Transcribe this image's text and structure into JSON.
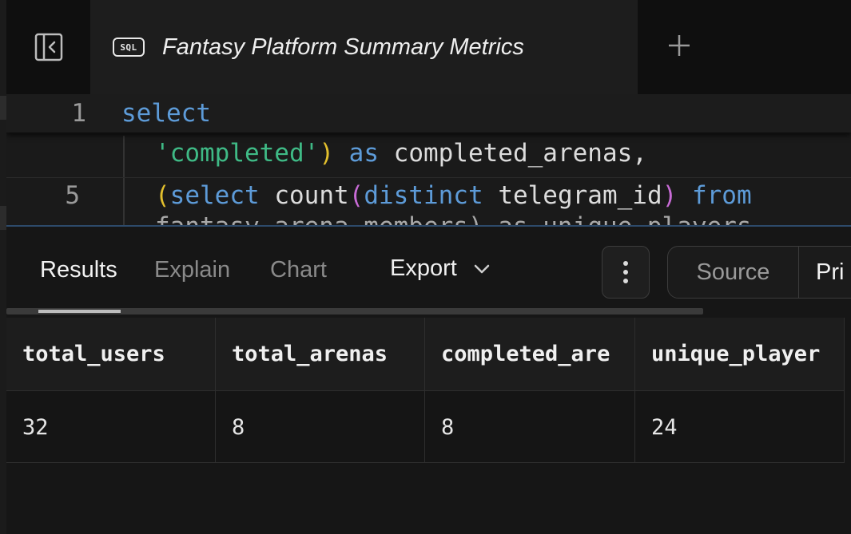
{
  "tab": {
    "icon_label": "SQL",
    "title": "Fantasy Platform Summary Metrics"
  },
  "editor": {
    "line_1_number": "1",
    "line_1_code": "select",
    "wrap_line": {
      "string": "'completed'",
      "paren_close": ")",
      "keyword": "as",
      "rest": "completed_arenas,"
    },
    "line_5_number": "5",
    "line_5": {
      "paren_open": "(",
      "select_kw": "select",
      "count_fn": "count",
      "inner_paren_open": "(",
      "distinct_kw": "distinct",
      "column": "telegram_id",
      "inner_paren_close": ")",
      "from_kw": "from"
    },
    "partial_line": "fantasy_arena_members) as unique_players"
  },
  "results_toolbar": {
    "tabs": [
      "Results",
      "Explain",
      "Chart"
    ],
    "active_tab": "Results",
    "export_label": "Export",
    "view_toggle": [
      "Source",
      "Pri"
    ]
  },
  "results": {
    "columns": [
      "total_users",
      "total_arenas",
      "completed_are",
      "unique_player"
    ],
    "rows": [
      [
        "32",
        "8",
        "8",
        "24"
      ]
    ]
  },
  "colors": {
    "keyword": "#5d9bd8",
    "string": "#3fba86",
    "paren_yellow": "#e3c02d",
    "paren_purple": "#c86bd6"
  },
  "icons": {
    "sidebar_toggle": "sidebar-collapse-icon",
    "sql": "sql-icon",
    "add_tab": "plus-icon",
    "export_dropdown": "chevron-down-icon",
    "more": "vertical-dots-icon"
  }
}
